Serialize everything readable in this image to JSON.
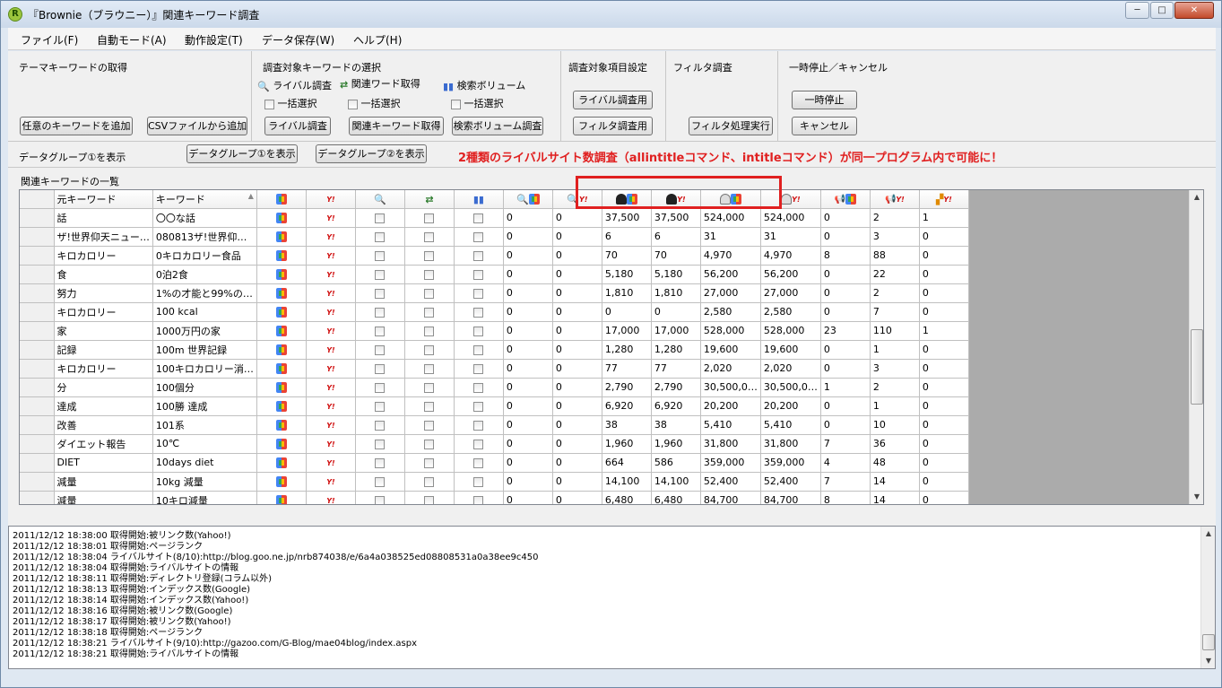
{
  "window": {
    "title": "『Brownie（ブラウニー）』関連キーワード調査",
    "icon_letter": "R",
    "minimize": "─",
    "maximize": "□",
    "close": "✕"
  },
  "menu": [
    "ファイル(F)",
    "自動モード(A)",
    "動作設定(T)",
    "データ保存(W)",
    "ヘルプ(H)"
  ],
  "groups": {
    "theme": {
      "title": "テーマキーワードの取得",
      "add_keyword": "任意のキーワードを追加",
      "add_csv": "CSVファイルから追加"
    },
    "target": {
      "title": "調査対象キーワードの選択",
      "rival": "ライバル調査",
      "related": "関連ワード取得",
      "volume": "検索ボリューム",
      "select_all": "一括選択",
      "btn_rival": "ライバル調査",
      "btn_related": "関連キーワード取得",
      "btn_volume": "検索ボリューム調査"
    },
    "items": {
      "title": "調査対象項目設定",
      "btn_rival": "ライバル調査用",
      "btn_filter": "フィルタ調査用"
    },
    "filter": {
      "title": "フィルタ調査",
      "btn": "フィルタ処理実行"
    },
    "pause": {
      "title": "一時停止／キャンセル",
      "btn_pause": "一時停止",
      "btn_cancel": "キャンセル"
    }
  },
  "datagroup": {
    "label": "データグループ①を表示",
    "btn1": "データグループ①を表示",
    "btn2": "データグループ②を表示"
  },
  "note": "2種類のライバルサイト数調査（allintitleコマンド、intitleコマンド）が同一プログラム内で可能に！",
  "list_label": "関連キーワードの一覧",
  "columns": {
    "orig": "元キーワード",
    "kw": "キーワード",
    "sort": "▲"
  },
  "rows": [
    [
      "話",
      "〇〇な話",
      "0",
      "0",
      "37,500",
      "37,500",
      "524,000",
      "524,000",
      "0",
      "2",
      "1"
    ],
    [
      "ザ!世界仰天ニュー…",
      "080813ザ!世界仰…",
      "0",
      "0",
      "6",
      "6",
      "31",
      "31",
      "0",
      "3",
      "0"
    ],
    [
      "キロカロリー",
      "0キロカロリー食品",
      "0",
      "0",
      "70",
      "70",
      "4,970",
      "4,970",
      "8",
      "88",
      "0"
    ],
    [
      "食",
      "0泊2食",
      "0",
      "0",
      "5,180",
      "5,180",
      "56,200",
      "56,200",
      "0",
      "22",
      "0"
    ],
    [
      "努力",
      "1%の才能と99%の…",
      "0",
      "0",
      "1,810",
      "1,810",
      "27,000",
      "27,000",
      "0",
      "2",
      "0"
    ],
    [
      "キロカロリー",
      "100 kcal",
      "0",
      "0",
      "0",
      "0",
      "2,580",
      "2,580",
      "0",
      "7",
      "0"
    ],
    [
      "家",
      "1000万円の家",
      "0",
      "0",
      "17,000",
      "17,000",
      "528,000",
      "528,000",
      "23",
      "110",
      "1"
    ],
    [
      "記録",
      "100m 世界記録",
      "0",
      "0",
      "1,280",
      "1,280",
      "19,600",
      "19,600",
      "0",
      "1",
      "0"
    ],
    [
      "キロカロリー",
      "100キロカロリー消…",
      "0",
      "0",
      "77",
      "77",
      "2,020",
      "2,020",
      "0",
      "3",
      "0"
    ],
    [
      "分",
      "100個分",
      "0",
      "0",
      "2,790",
      "2,790",
      "30,500,0…",
      "30,500,0…",
      "1",
      "2",
      "0"
    ],
    [
      "達成",
      "100勝 達成",
      "0",
      "0",
      "6,920",
      "6,920",
      "20,200",
      "20,200",
      "0",
      "1",
      "0"
    ],
    [
      "改善",
      "101系",
      "0",
      "0",
      "38",
      "38",
      "5,410",
      "5,410",
      "0",
      "10",
      "0"
    ],
    [
      "ダイエット報告",
      "10℃",
      "0",
      "0",
      "1,960",
      "1,960",
      "31,800",
      "31,800",
      "7",
      "36",
      "0"
    ],
    [
      "DIET",
      "10days diet",
      "0",
      "0",
      "664",
      "586",
      "359,000",
      "359,000",
      "4",
      "48",
      "0"
    ],
    [
      "減量",
      "10kg 減量",
      "0",
      "0",
      "14,100",
      "14,100",
      "52,400",
      "52,400",
      "7",
      "14",
      "0"
    ],
    [
      "減量",
      "10キロ減量",
      "0",
      "0",
      "6,480",
      "6,480",
      "84,700",
      "84,700",
      "8",
      "14",
      "0"
    ]
  ],
  "log": [
    "2011/12/12 18:38:00 取得開始:被リンク数(Yahoo!)",
    "2011/12/12 18:38:01 取得開始:ページランク",
    "2011/12/12 18:38:04 ライバルサイト(8/10):http://blog.goo.ne.jp/nrb874038/e/6a4a038525ed08808531a0a38ee9c450",
    "2011/12/12 18:38:04 取得開始:ライバルサイトの情報",
    "2011/12/12 18:38:11 取得開始:ディレクトリ登録(コラム以外)",
    "2011/12/12 18:38:13 取得開始:インデックス数(Google)",
    "2011/12/12 18:38:14 取得開始:インデックス数(Yahoo!)",
    "2011/12/12 18:38:16 取得開始:被リンク数(Google)",
    "2011/12/12 18:38:17 取得開始:被リンク数(Yahoo!)",
    "2011/12/12 18:38:18 取得開始:ページランク",
    "2011/12/12 18:38:21 ライバルサイト(9/10):http://gazoo.com/G-Blog/mae04blog/index.aspx",
    "2011/12/12 18:38:21 取得開始:ライバルサイトの情報"
  ]
}
